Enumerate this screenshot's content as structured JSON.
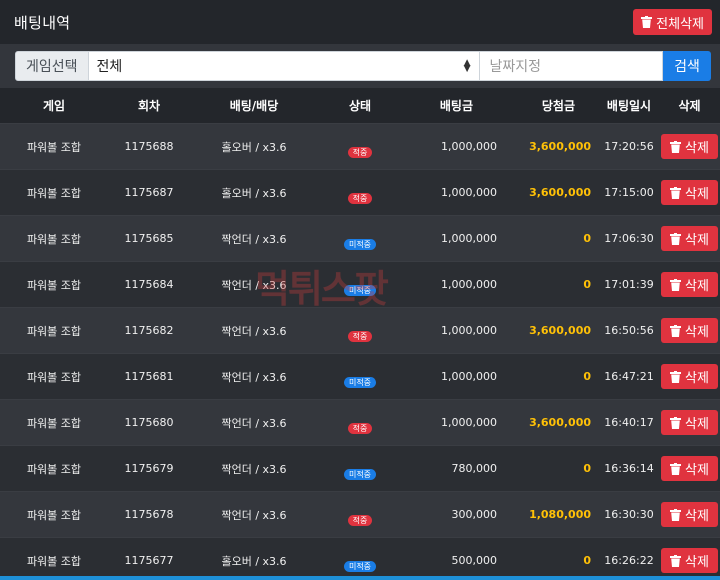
{
  "header": {
    "title": "배팅내역",
    "delete_all_label": "전체삭제"
  },
  "filter": {
    "game_select_label": "게임선택",
    "game_select_value": "전체",
    "date_placeholder": "날짜지정",
    "search_label": "검색"
  },
  "table": {
    "columns": [
      "게임",
      "회차",
      "배팅/배당",
      "상태",
      "배팅금",
      "당첨금",
      "배팅일시",
      "삭제"
    ],
    "rows": [
      {
        "game": "파워볼 조합",
        "round": "1175688",
        "bet": "홀오버 / x3.6",
        "status": "적중",
        "amount": "1,000,000",
        "payout": "3,600,000",
        "time": "17:20:56",
        "delete": "삭제"
      },
      {
        "game": "파워볼 조합",
        "round": "1175687",
        "bet": "홀오버 / x3.6",
        "status": "적중",
        "amount": "1,000,000",
        "payout": "3,600,000",
        "time": "17:15:00",
        "delete": "삭제"
      },
      {
        "game": "파워볼 조합",
        "round": "1175685",
        "bet": "짝언더 / x3.6",
        "status": "미적중",
        "amount": "1,000,000",
        "payout": "0",
        "time": "17:06:30",
        "delete": "삭제"
      },
      {
        "game": "파워볼 조합",
        "round": "1175684",
        "bet": "짝언더 / x3.6",
        "status": "미적중",
        "amount": "1,000,000",
        "payout": "0",
        "time": "17:01:39",
        "delete": "삭제"
      },
      {
        "game": "파워볼 조합",
        "round": "1175682",
        "bet": "짝언더 / x3.6",
        "status": "적중",
        "amount": "1,000,000",
        "payout": "3,600,000",
        "time": "16:50:56",
        "delete": "삭제"
      },
      {
        "game": "파워볼 조합",
        "round": "1175681",
        "bet": "짝언더 / x3.6",
        "status": "미적중",
        "amount": "1,000,000",
        "payout": "0",
        "time": "16:47:21",
        "delete": "삭제"
      },
      {
        "game": "파워볼 조합",
        "round": "1175680",
        "bet": "짝언더 / x3.6",
        "status": "적중",
        "amount": "1,000,000",
        "payout": "3,600,000",
        "time": "16:40:17",
        "delete": "삭제"
      },
      {
        "game": "파워볼 조합",
        "round": "1175679",
        "bet": "짝언더 / x3.6",
        "status": "미적중",
        "amount": "780,000",
        "payout": "0",
        "time": "16:36:14",
        "delete": "삭제"
      },
      {
        "game": "파워볼 조합",
        "round": "1175678",
        "bet": "짝언더 / x3.6",
        "status": "적중",
        "amount": "300,000",
        "payout": "1,080,000",
        "time": "16:30:30",
        "delete": "삭제"
      },
      {
        "game": "파워볼 조합",
        "round": "1175677",
        "bet": "홀오버 / x3.6",
        "status": "미적중",
        "amount": "500,000",
        "payout": "0",
        "time": "16:26:22",
        "delete": "삭제"
      }
    ]
  },
  "watermark": "먹튀스팟",
  "colors": {
    "danger": "#e0333f",
    "primary": "#1a7de6",
    "payout": "#ffc107",
    "background": "#2c2f35"
  },
  "icons": {
    "delete": "trash-icon",
    "select": "chevron-updown-icon"
  }
}
